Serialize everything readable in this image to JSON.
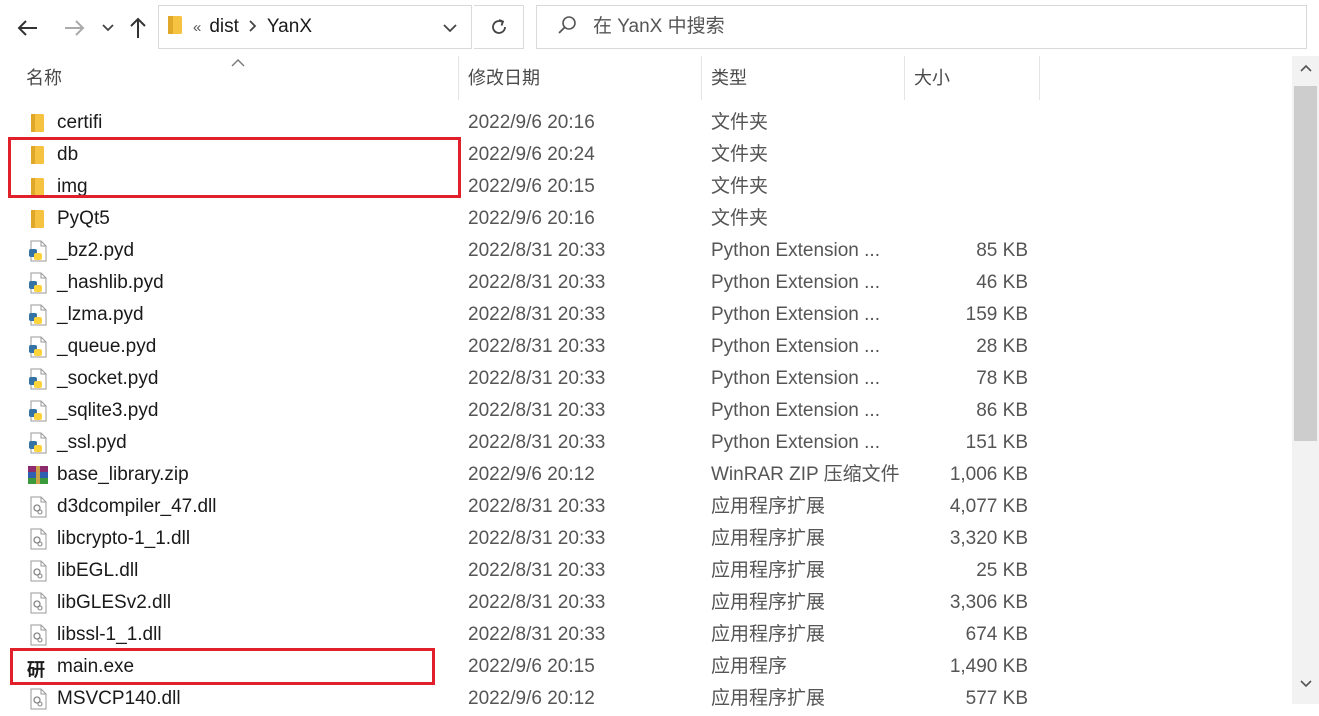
{
  "toolbar": {
    "address": {
      "sep": "«",
      "crumbs": [
        "dist",
        "YanX"
      ]
    },
    "search_placeholder": "在 YanX 中搜索",
    "icons": [
      "back-arrow-icon",
      "forward-arrow-icon",
      "chevron-down-icon",
      "up-arrow-icon",
      "refresh-icon",
      "search-icon"
    ]
  },
  "columns": {
    "name": "名称",
    "date": "修改日期",
    "type": "类型",
    "size": "大小"
  },
  "files": [
    {
      "name": "certifi",
      "date": "2022/9/6 20:16",
      "type": "文件夹",
      "size": "",
      "icon": "folder-icon"
    },
    {
      "name": "db",
      "date": "2022/9/6 20:24",
      "type": "文件夹",
      "size": "",
      "icon": "folder-icon"
    },
    {
      "name": "img",
      "date": "2022/9/6 20:15",
      "type": "文件夹",
      "size": "",
      "icon": "folder-icon"
    },
    {
      "name": "PyQt5",
      "date": "2022/9/6 20:16",
      "type": "文件夹",
      "size": "",
      "icon": "folder-icon"
    },
    {
      "name": "_bz2.pyd",
      "date": "2022/8/31 20:33",
      "type": "Python Extension ...",
      "size": "85 KB",
      "icon": "python-file-icon"
    },
    {
      "name": "_hashlib.pyd",
      "date": "2022/8/31 20:33",
      "type": "Python Extension ...",
      "size": "46 KB",
      "icon": "python-file-icon"
    },
    {
      "name": "_lzma.pyd",
      "date": "2022/8/31 20:33",
      "type": "Python Extension ...",
      "size": "159 KB",
      "icon": "python-file-icon"
    },
    {
      "name": "_queue.pyd",
      "date": "2022/8/31 20:33",
      "type": "Python Extension ...",
      "size": "28 KB",
      "icon": "python-file-icon"
    },
    {
      "name": "_socket.pyd",
      "date": "2022/8/31 20:33",
      "type": "Python Extension ...",
      "size": "78 KB",
      "icon": "python-file-icon"
    },
    {
      "name": "_sqlite3.pyd",
      "date": "2022/8/31 20:33",
      "type": "Python Extension ...",
      "size": "86 KB",
      "icon": "python-file-icon"
    },
    {
      "name": "_ssl.pyd",
      "date": "2022/8/31 20:33",
      "type": "Python Extension ...",
      "size": "151 KB",
      "icon": "python-file-icon"
    },
    {
      "name": "base_library.zip",
      "date": "2022/9/6 20:12",
      "type": "WinRAR ZIP 压缩文件",
      "size": "1,006 KB",
      "icon": "winrar-archive-icon"
    },
    {
      "name": "d3dcompiler_47.dll",
      "date": "2022/8/31 20:33",
      "type": "应用程序扩展",
      "size": "4,077 KB",
      "icon": "dll-file-icon"
    },
    {
      "name": "libcrypto-1_1.dll",
      "date": "2022/8/31 20:33",
      "type": "应用程序扩展",
      "size": "3,320 KB",
      "icon": "dll-file-icon"
    },
    {
      "name": "libEGL.dll",
      "date": "2022/8/31 20:33",
      "type": "应用程序扩展",
      "size": "25 KB",
      "icon": "dll-file-icon"
    },
    {
      "name": "libGLESv2.dll",
      "date": "2022/8/31 20:33",
      "type": "应用程序扩展",
      "size": "3,306 KB",
      "icon": "dll-file-icon"
    },
    {
      "name": "libssl-1_1.dll",
      "date": "2022/8/31 20:33",
      "type": "应用程序扩展",
      "size": "674 KB",
      "icon": "dll-file-icon"
    },
    {
      "name": "main.exe",
      "date": "2022/9/6 20:15",
      "type": "应用程序",
      "size": "1,490 KB",
      "icon": "app-exe-icon",
      "icon_glyph": "研"
    },
    {
      "name": "MSVCP140.dll",
      "date": "2022/9/6 20:12",
      "type": "应用程序扩展",
      "size": "577 KB",
      "icon": "dll-file-icon"
    }
  ],
  "highlight_color": "#e0202a",
  "folder_color": "#f5c242"
}
